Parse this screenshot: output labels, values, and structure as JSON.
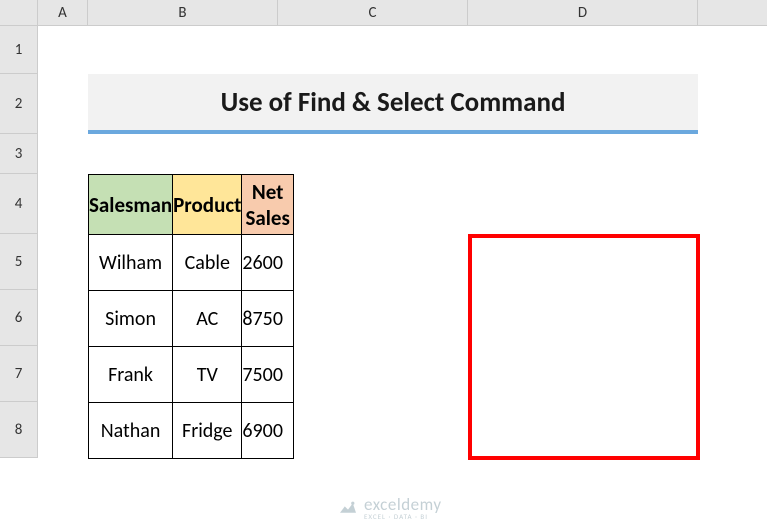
{
  "columns": [
    "A",
    "B",
    "C",
    "D"
  ],
  "rows": [
    "1",
    "2",
    "3",
    "4",
    "5",
    "6",
    "7",
    "8"
  ],
  "title": "Use of Find & Select Command",
  "headers": {
    "salesman": "Salesman",
    "product": "Product",
    "netsales": "Net Sales"
  },
  "chart_data": {
    "type": "table",
    "columns": [
      "Salesman",
      "Product",
      "Net Sales"
    ],
    "rows": [
      {
        "salesman": "Wilham",
        "product": "Cable",
        "netsales": 2600
      },
      {
        "salesman": "Simon",
        "product": "AC",
        "netsales": 8750
      },
      {
        "salesman": "Frank",
        "product": "TV",
        "netsales": 7500
      },
      {
        "salesman": "Nathan",
        "product": "Fridge",
        "netsales": 6900
      }
    ]
  },
  "watermark": {
    "main": "exceldemy",
    "sub": "EXCEL · DATA · BI"
  }
}
